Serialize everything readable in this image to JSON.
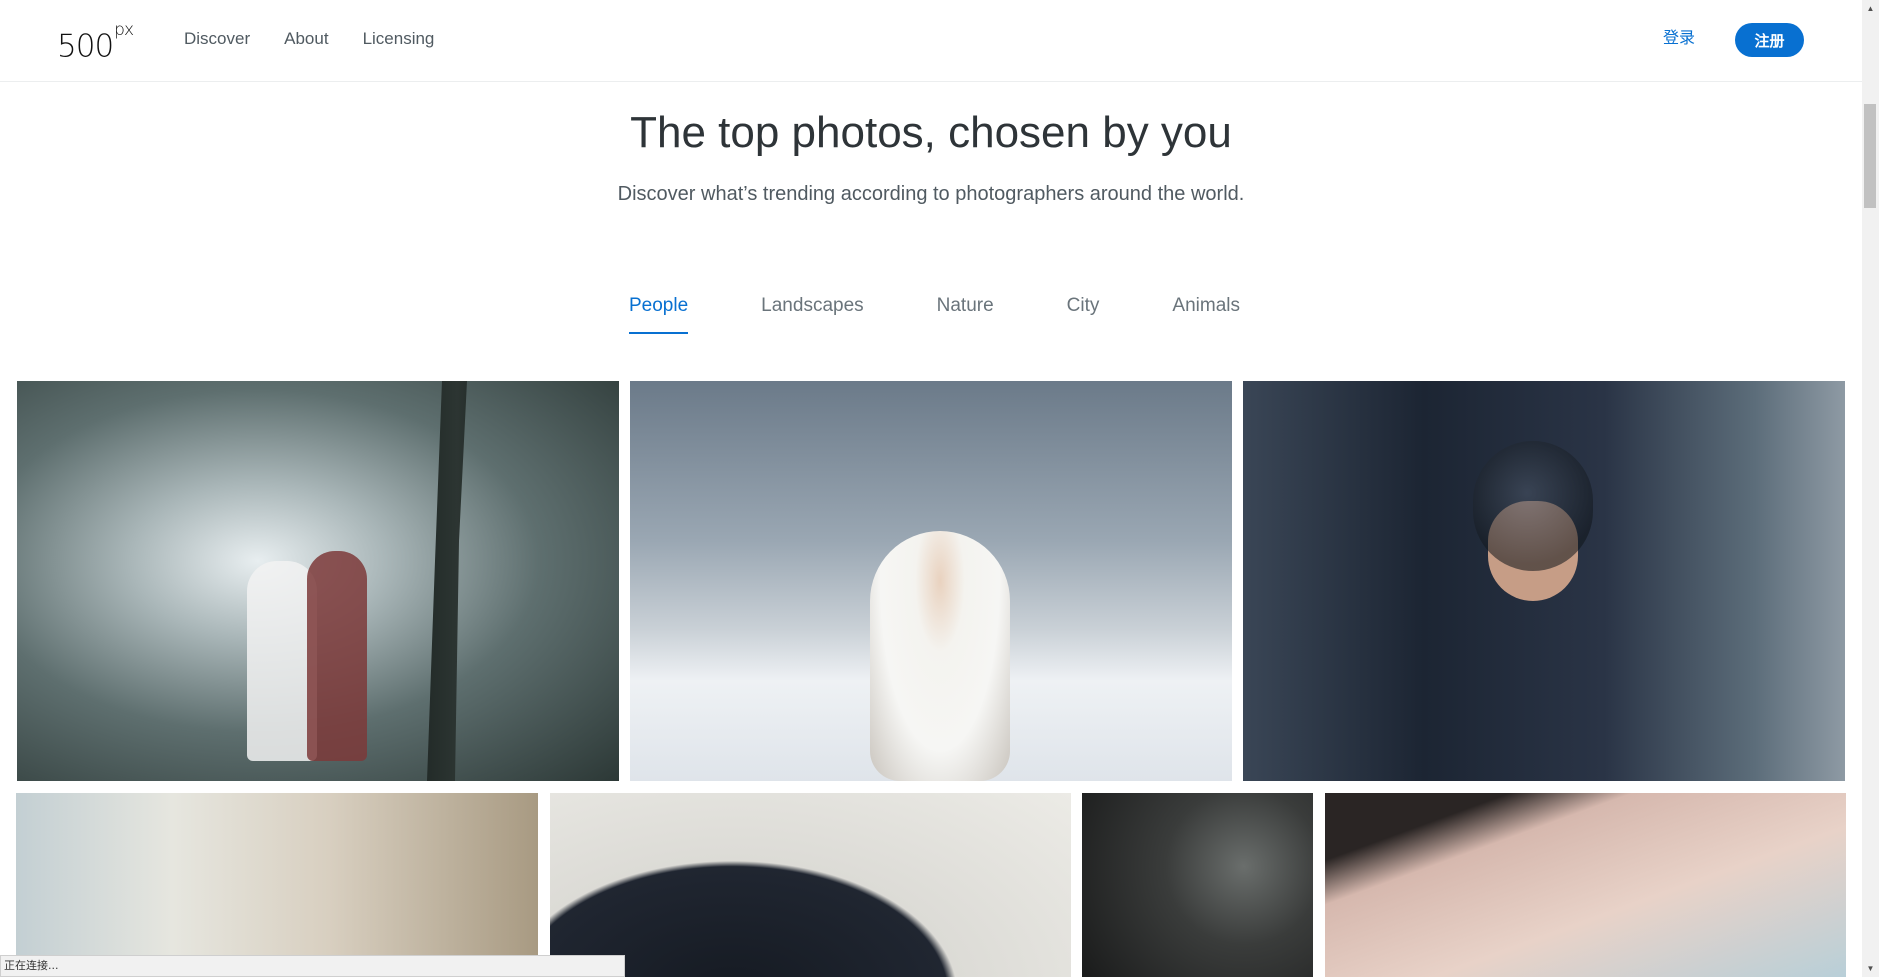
{
  "header": {
    "logo": "500",
    "logo_suffix": "px",
    "nav": [
      "Discover",
      "About",
      "Licensing"
    ],
    "login_label": "登录",
    "signup_label": "注册",
    "accent_color": "#0870d1"
  },
  "hero": {
    "title": "The top photos, chosen by you",
    "subtitle": "Discover what’s trending according to photographers around the world."
  },
  "tabs": {
    "items": [
      "People",
      "Landscapes",
      "Nature",
      "City",
      "Animals"
    ],
    "active": "People"
  },
  "status_bar": {
    "text": "正在连接..."
  },
  "scrollbar": {
    "up_icon": "▲",
    "down_icon": "▼"
  }
}
